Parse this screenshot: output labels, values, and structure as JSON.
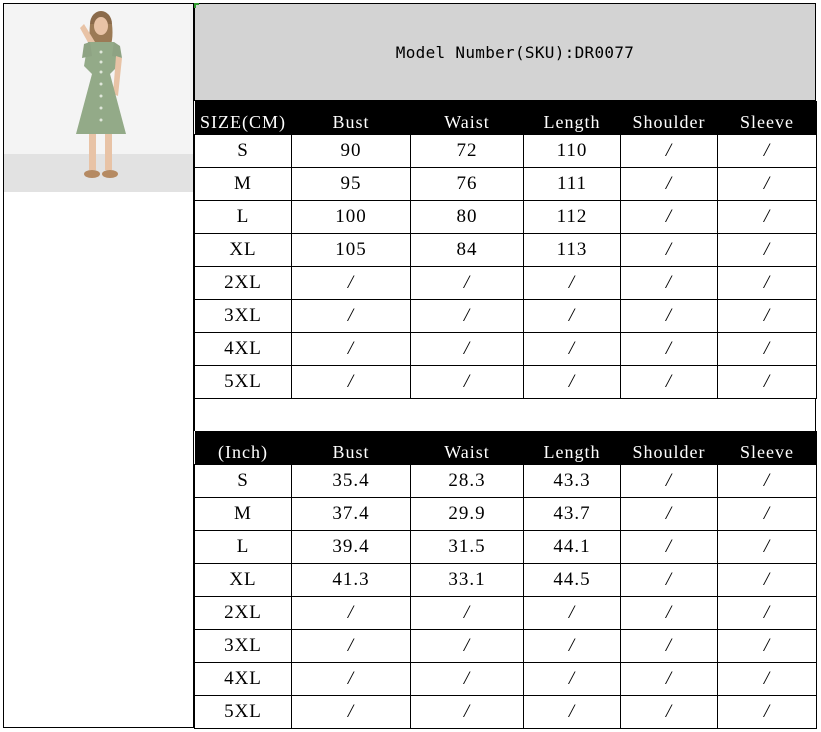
{
  "sku_label": "Model Number(SKU):DR0077",
  "cm_table": {
    "headers": [
      "SIZE(CM)",
      "Bust",
      "Waist",
      "Length",
      "Shoulder",
      "Sleeve"
    ],
    "rows": [
      [
        "S",
        "90",
        "72",
        "110",
        "/",
        "/"
      ],
      [
        "M",
        "95",
        "76",
        "111",
        "/",
        "/"
      ],
      [
        "L",
        "100",
        "80",
        "112",
        "/",
        "/"
      ],
      [
        "XL",
        "105",
        "84",
        "113",
        "/",
        "/"
      ],
      [
        "2XL",
        "/",
        "/",
        "/",
        "/",
        "/"
      ],
      [
        "3XL",
        "/",
        "/",
        "/",
        "/",
        "/"
      ],
      [
        "4XL",
        "/",
        "/",
        "/",
        "/",
        "/"
      ],
      [
        "5XL",
        "/",
        "/",
        "/",
        "/",
        "/"
      ]
    ]
  },
  "inch_table": {
    "headers": [
      "(Inch)",
      "Bust",
      "Waist",
      "Length",
      "Shoulder",
      "Sleeve"
    ],
    "rows": [
      [
        "S",
        "35.4",
        "28.3",
        "43.3",
        "/",
        "/"
      ],
      [
        "M",
        "37.4",
        "29.9",
        "43.7",
        "/",
        "/"
      ],
      [
        "L",
        "39.4",
        "31.5",
        "44.1",
        "/",
        "/"
      ],
      [
        "XL",
        "41.3",
        "33.1",
        "44.5",
        "/",
        "/"
      ],
      [
        "2XL",
        "/",
        "/",
        "/",
        "/",
        "/"
      ],
      [
        "3XL",
        "/",
        "/",
        "/",
        "/",
        "/"
      ],
      [
        "4XL",
        "/",
        "/",
        "/",
        "/",
        "/"
      ],
      [
        "5XL",
        "/",
        "/",
        "/",
        "/",
        "/"
      ]
    ]
  },
  "colors": {
    "header_band": "#d3d3d3",
    "table_header_bg": "#000000",
    "dress": "#93aa88"
  }
}
